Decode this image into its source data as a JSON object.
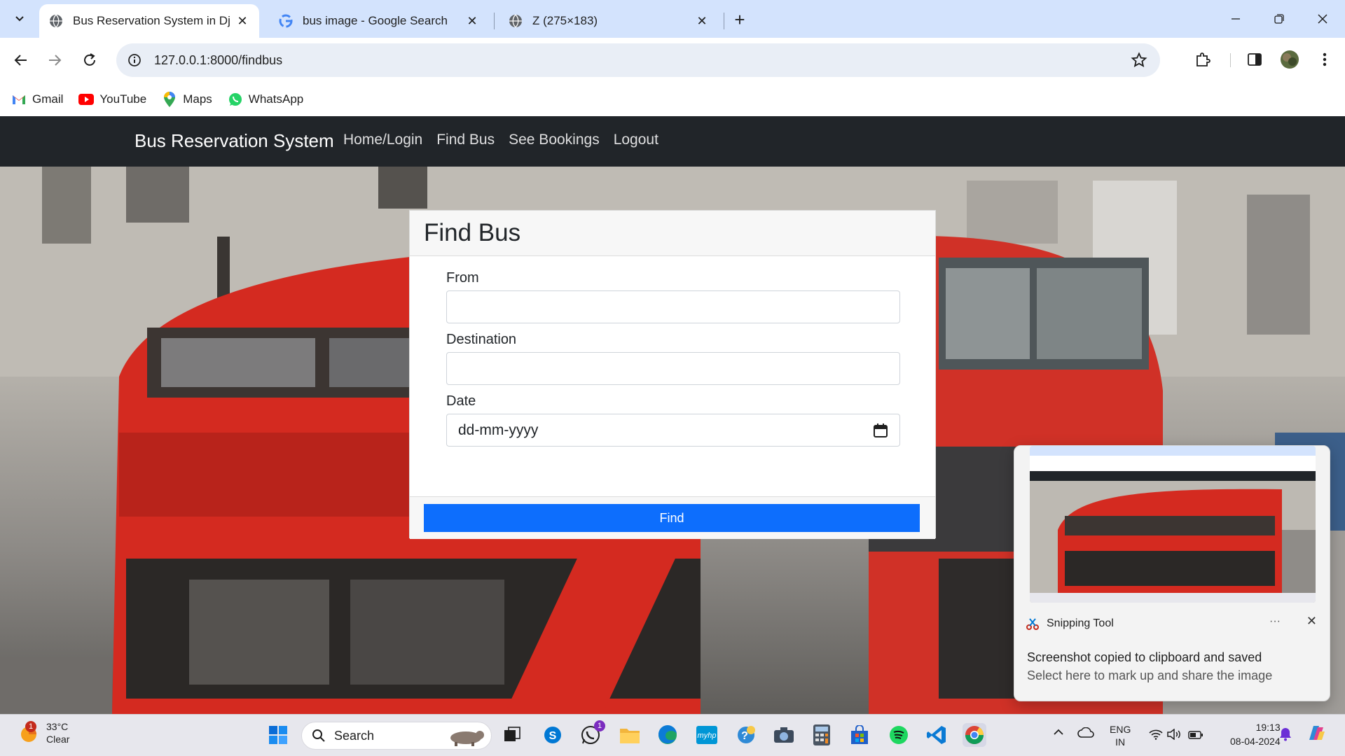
{
  "browser": {
    "tabs": [
      {
        "title": "Bus Reservation System in Djan",
        "active": true
      },
      {
        "title": "bus image - Google Search",
        "active": false
      },
      {
        "title": "Z (275×183)",
        "active": false
      }
    ],
    "url": "127.0.0.1:8000/findbus",
    "bookmarks": [
      {
        "label": "Gmail",
        "icon": "gmail-icon"
      },
      {
        "label": "YouTube",
        "icon": "youtube-icon"
      },
      {
        "label": "Maps",
        "icon": "maps-icon"
      },
      {
        "label": "WhatsApp",
        "icon": "whatsapp-icon"
      }
    ]
  },
  "site": {
    "brand": "Bus Reservation System",
    "nav": [
      "Home/Login",
      "Find Bus",
      "See Bookings",
      "Logout"
    ]
  },
  "form": {
    "title": "Find Bus",
    "from_label": "From",
    "from_value": "",
    "destination_label": "Destination",
    "destination_value": "",
    "date_label": "Date",
    "date_placeholder": "dd-mm-yyyy",
    "submit_label": "Find"
  },
  "toast": {
    "app": "Snipping Tool",
    "more": "···",
    "message": "Screenshot copied to clipboard and saved",
    "sub": "Select here to mark up and share the image"
  },
  "taskbar": {
    "weather_temp": "33°C",
    "weather_desc": "Clear",
    "weather_badge": "1",
    "search_placeholder": "Search",
    "whatsapp_badge": "1",
    "lang_line1": "ENG",
    "lang_line2": "IN",
    "time": "19:13",
    "date": "08-04-2024"
  },
  "colors": {
    "tabstrip": "#d3e3fd",
    "navbar": "#212529",
    "primary_button": "#0d6efd",
    "bus_red": "#d42a20"
  }
}
